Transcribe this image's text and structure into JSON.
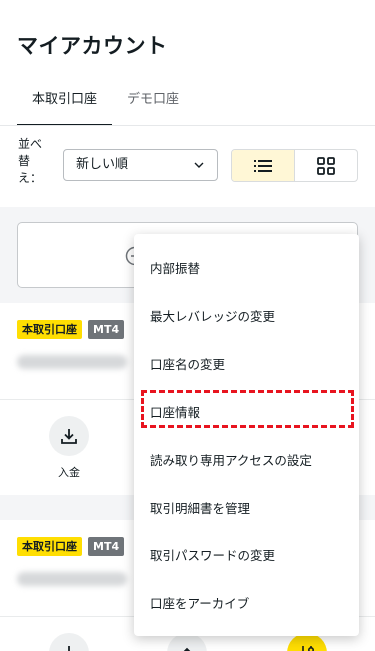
{
  "page": {
    "title": "マイアカウント"
  },
  "tabs": [
    {
      "label": "本取引口座",
      "active": true
    },
    {
      "label": "デモ口座",
      "active": false
    }
  ],
  "sort": {
    "label": "並べ替え：",
    "selected": "新しい順",
    "view_modes": [
      "list-icon",
      "grid-icon"
    ],
    "active_view": "list"
  },
  "open_account": {
    "icon": "plus-circle-icon"
  },
  "accounts": [
    {
      "type_badge": "本取引口座",
      "platform_badge": "MT4",
      "actions": [
        {
          "label": "入金",
          "icon": "download-icon"
        }
      ]
    },
    {
      "type_badge": "本取引口座",
      "platform_badge": "MT4",
      "actions": [
        {
          "icon": "download-icon"
        },
        {
          "icon": "upload-icon"
        },
        {
          "icon": "sliders-icon"
        }
      ]
    }
  ],
  "menu": {
    "items": [
      "内部振替",
      "最大レバレッジの変更",
      "口座名の変更",
      "口座情報",
      "読み取り専用アクセスの設定",
      "取引明細書を管理",
      "取引パスワードの変更",
      "口座をアーカイブ"
    ],
    "highlighted_index": 3
  },
  "colors": {
    "accent": "#ffde02",
    "highlight": "#e8141f",
    "text": "#141d22"
  }
}
